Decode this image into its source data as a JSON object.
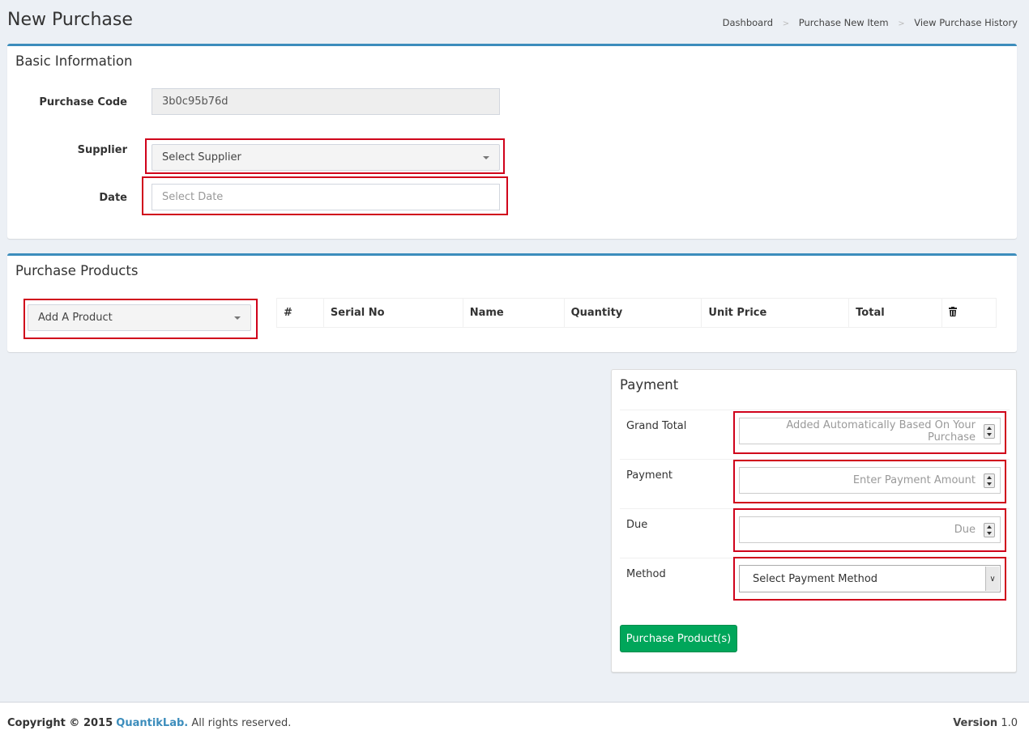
{
  "header": {
    "title": "New Purchase",
    "breadcrumb": [
      "Dashboard",
      "Purchase New Item",
      "View Purchase History"
    ]
  },
  "basic_info": {
    "title": "Basic Information",
    "purchase_code_label": "Purchase Code",
    "purchase_code_value": "3b0c95b76d",
    "supplier_label": "Supplier",
    "supplier_value": "Select Supplier",
    "date_label": "Date",
    "date_placeholder": "Select Date"
  },
  "products": {
    "title": "Purchase Products",
    "add_product": "Add A Product",
    "columns": [
      "#",
      "Serial No",
      "Name",
      "Quantity",
      "Unit Price",
      "Total"
    ],
    "delete_icon": "trash-icon"
  },
  "payment": {
    "title": "Payment",
    "grand_total_label": "Grand Total",
    "grand_total_placeholder": "Added Automatically Based On Your Purchase",
    "payment_label": "Payment",
    "payment_placeholder": "Enter Payment Amount",
    "due_label": "Due",
    "due_placeholder": "Due",
    "method_label": "Method",
    "method_value": "Select Payment Method",
    "submit_label": "Purchase Product(s)"
  },
  "footer": {
    "copyright_prefix": "Copyright © 2015",
    "brand": "QuantikLab.",
    "copyright_suffix": "All rights reserved.",
    "version_label": "Version",
    "version_value": "1.0"
  },
  "colors": {
    "accent": "#3c8dbc",
    "highlight": "#d0021b",
    "success": "#00a65a",
    "background": "#ecf0f5"
  }
}
